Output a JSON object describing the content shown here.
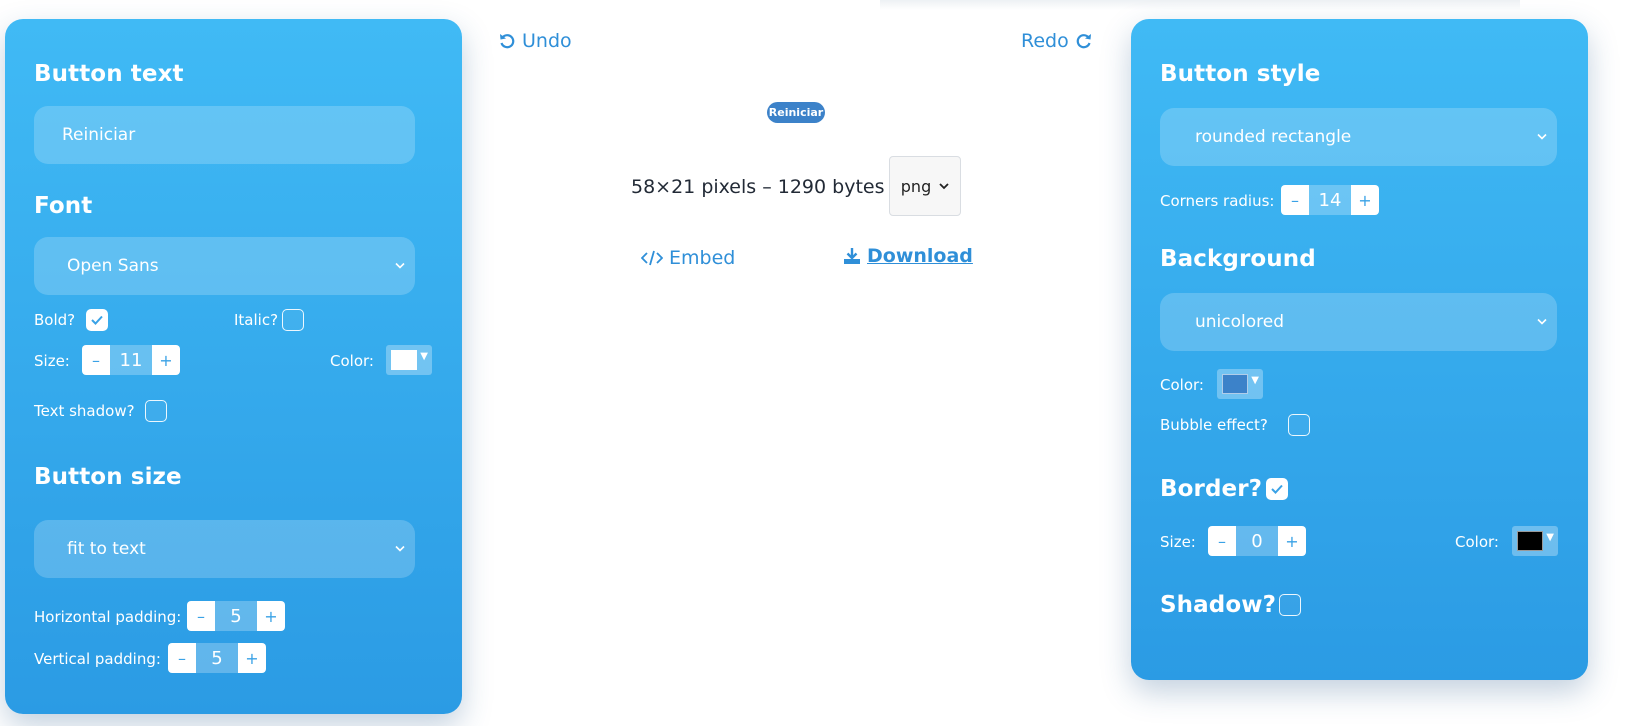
{
  "toolbar": {
    "undo_label": "Undo",
    "redo_label": "Redo"
  },
  "preview": {
    "button_text": "Reiniciar",
    "info": "58×21 pixels – 1290 bytes in",
    "format_selected": "png",
    "embed_label": "Embed",
    "download_label": "Download",
    "button_color": "#3c82c9"
  },
  "left_panel": {
    "button_text": {
      "heading": "Button text",
      "value": "Reiniciar"
    },
    "font": {
      "heading": "Font",
      "selected": "Open Sans",
      "bold_label": "Bold?",
      "bold_checked": true,
      "italic_label": "Italic?",
      "italic_checked": false,
      "size_label": "Size:",
      "size_value": "11",
      "color_label": "Color:",
      "color_value": "#ffffff",
      "shadow_label": "Text shadow?",
      "shadow_checked": false
    },
    "button_size": {
      "heading": "Button size",
      "selected": "fit to text",
      "hpad_label": "Horizontal padding:",
      "hpad_value": "5",
      "vpad_label": "Vertical padding:",
      "vpad_value": "5"
    }
  },
  "right_panel": {
    "style": {
      "heading": "Button style",
      "selected": "rounded rectangle",
      "radius_label": "Corners radius:",
      "radius_value": "14"
    },
    "background": {
      "heading": "Background",
      "selected": "unicolored",
      "color_label": "Color:",
      "color_value": "#3c82c9",
      "bubble_label": "Bubble effect?",
      "bubble_checked": false
    },
    "border": {
      "heading": "Border?",
      "checked": true,
      "size_label": "Size:",
      "size_value": "0",
      "color_label": "Color:",
      "color_value": "#000000"
    },
    "shadow": {
      "heading": "Shadow?",
      "checked": false
    }
  },
  "stepper_symbols": {
    "minus": "–",
    "plus": "+"
  },
  "colors": {
    "panel_top": "#40baf5",
    "panel_bottom": "#2b9be4",
    "link": "#2f8fd8"
  }
}
